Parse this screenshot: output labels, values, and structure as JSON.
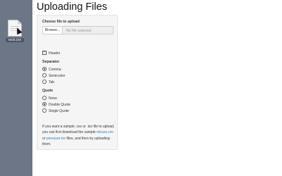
{
  "desktop": {
    "file_label": "rock.csv"
  },
  "page": {
    "title": "Uploading Files"
  },
  "upload": {
    "label": "Choose file to upload",
    "browse_label": "Browse...",
    "placeholder": "No file selected"
  },
  "header": {
    "label": "Header",
    "checked": true
  },
  "separator": {
    "label": "Separator",
    "options": [
      "Comma",
      "Semicolon",
      "Tab"
    ],
    "selected": "Comma"
  },
  "quote": {
    "label": "Quote",
    "options": [
      "None",
      "Double Quote",
      "Single Quote"
    ],
    "selected": "Double Quote"
  },
  "help": {
    "text_1": "If you want a sample .csv or .tsv file to upload, you can first download the sample",
    "link_1": "mtcars.csv",
    "text_2": "or",
    "link_2": "pressure.tsv",
    "text_3": "files, and then try uploading them."
  },
  "colors": {
    "link": "#337ab7",
    "desktop": "#6c7686",
    "panel": "#f5f5f5"
  }
}
